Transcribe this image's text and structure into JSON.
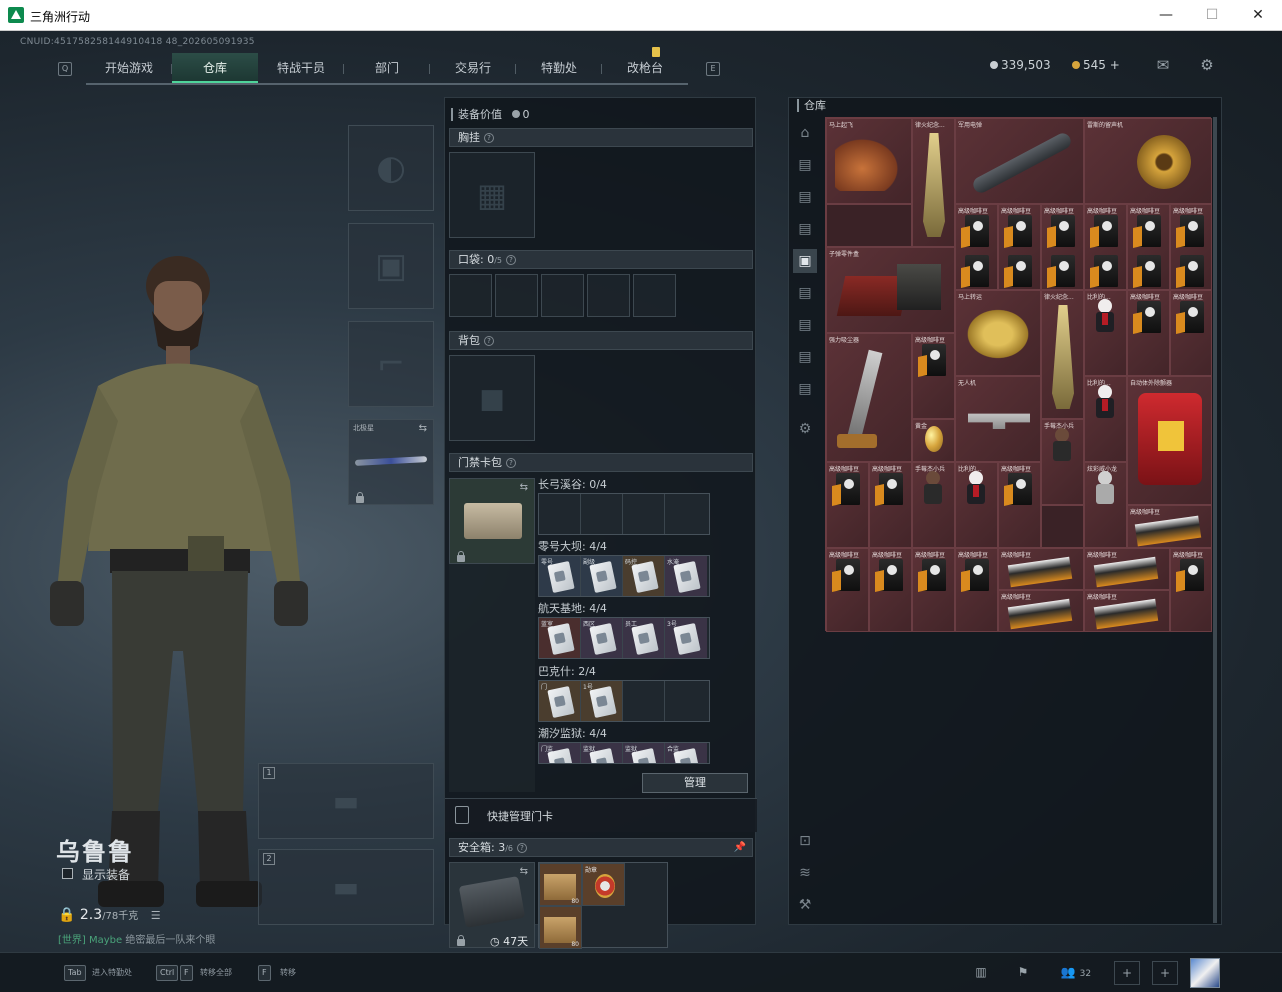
{
  "window": {
    "title": "三角洲行动",
    "minimize": "—",
    "maximize": "☐",
    "close": "✕"
  },
  "uid": "CNUID:451758258144910418 48_202605091935",
  "nav": {
    "tabs": [
      "开始游戏",
      "仓库",
      "特战干员",
      "部门",
      "交易行",
      "特勤处",
      "改枪台"
    ],
    "active": "仓库",
    "left_key": "Q",
    "right_key": "E"
  },
  "currency": {
    "coins": "339,503",
    "tokens": "545",
    "add": "+"
  },
  "operator": {
    "name": "乌鲁鲁",
    "show_equipment_label": "显示装备",
    "weight": "2.3",
    "weight_max": "/78千克",
    "chat_channel": "[世界]",
    "chat_user": "Maybe",
    "chat_msg": "绝密最后一队来个眼"
  },
  "loadout": {
    "melee_label": "北极星",
    "weapon_slot_1": "1",
    "weapon_slot_2": "2"
  },
  "equipment": {
    "value_label": "装备价值",
    "value": "0",
    "chest_rig": "胸挂",
    "pockets": "口袋:",
    "pockets_count": "0",
    "pockets_max": "/5",
    "backpack": "背包",
    "keycard_bag": "门禁卡包",
    "quick_manage": "快捷管理门卡",
    "manage_btn": "管理",
    "safe_box": "安全箱:",
    "safe_count": "3",
    "safe_max": "/6",
    "safe_days": "47天",
    "safe_items": [
      {
        "label": "",
        "count": "80"
      },
      {
        "label": "勋章",
        "count": ""
      },
      {
        "label": "",
        "count": "80"
      }
    ]
  },
  "keycards": [
    {
      "map": "长弓溪谷: 0/4",
      "cards": [
        "",
        "",
        "",
        ""
      ]
    },
    {
      "map": "零号大坝: 4/4",
      "cards": [
        "零号",
        "副级",
        "码控",
        "水淹"
      ]
    },
    {
      "map": "航天基地: 4/4",
      "cards": [
        "蓝室",
        "西区",
        "员工",
        "3号"
      ]
    },
    {
      "map": "巴克什: 2/4",
      "cards": [
        "门",
        "1号",
        "",
        ""
      ]
    },
    {
      "map": "潮汐监狱: 4/4",
      "cards": [
        "门监",
        "监狱",
        "监狱",
        "合监"
      ]
    }
  ],
  "stash": {
    "title": "仓库",
    "items": [
      {
        "name": "马上起飞"
      },
      {
        "name": "律火纪念..."
      },
      {
        "name": "军用电弹"
      },
      {
        "name": "雷斯的留声机"
      },
      {
        "name": "高级咖啡豆"
      },
      {
        "name": "子弹零件盒"
      },
      {
        "name": "马上转运"
      },
      {
        "name": "律火纪念..."
      },
      {
        "name": "比利的..."
      },
      {
        "name": "强力吸尘器"
      },
      {
        "name": "无人机"
      },
      {
        "name": "手莓杰小兵"
      },
      {
        "name": "自动体外除颤器"
      },
      {
        "name": "炫彩威小龙"
      },
      {
        "name": "黄金"
      }
    ]
  },
  "bottom": {
    "tab_key": "Tab",
    "tab_lbl": "进入特勤处",
    "ctrl_key": "Ctrl",
    "f_key": "F",
    "ctrlf_lbl": "转移全部",
    "f2_key": "F",
    "f2_lbl": "转移",
    "friends": "32",
    "add1": "+",
    "add2": "+"
  },
  "colors": {
    "accent": "#4fd49a",
    "stash_bg": "#4a2a2e",
    "gold": "#d6a43c"
  }
}
